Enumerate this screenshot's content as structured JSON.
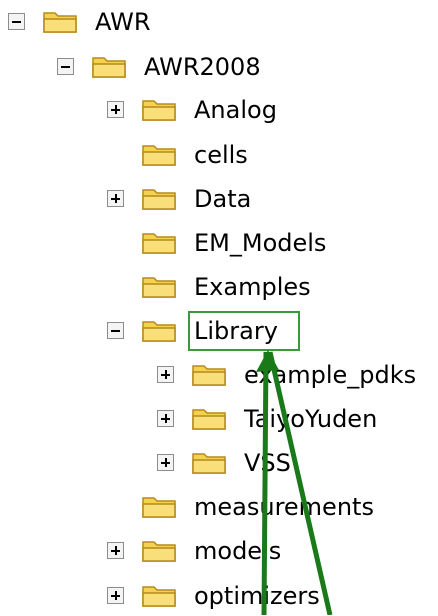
{
  "tree": {
    "items": [
      {
        "label": "AWR",
        "level": 0,
        "toggle": "collapse"
      },
      {
        "label": "AWR2008",
        "level": 1,
        "toggle": "collapse"
      },
      {
        "label": "Analog",
        "level": 2,
        "toggle": "expand"
      },
      {
        "label": "cells",
        "level": 2,
        "toggle": "none"
      },
      {
        "label": "Data",
        "level": 2,
        "toggle": "expand"
      },
      {
        "label": "EM_Models",
        "level": 2,
        "toggle": "none"
      },
      {
        "label": "Examples",
        "level": 2,
        "toggle": "none"
      },
      {
        "label": "Library",
        "level": 2,
        "toggle": "collapse",
        "highlighted": true
      },
      {
        "label": "example_pdks",
        "level": 3,
        "toggle": "expand"
      },
      {
        "label": "TaiyoYuden",
        "level": 3,
        "toggle": "expand"
      },
      {
        "label": "VSS",
        "level": 3,
        "toggle": "expand"
      },
      {
        "label": "measurements",
        "level": 2,
        "toggle": "none"
      },
      {
        "label": "models",
        "level": 2,
        "toggle": "expand"
      },
      {
        "label": "optimizers",
        "level": 2,
        "toggle": "expand"
      }
    ]
  },
  "colors": {
    "folder_fill": "#f5d24e",
    "folder_stroke": "#b58a1d",
    "highlight_box": "#3a9a3a",
    "arrow": "#1a7a1a"
  }
}
